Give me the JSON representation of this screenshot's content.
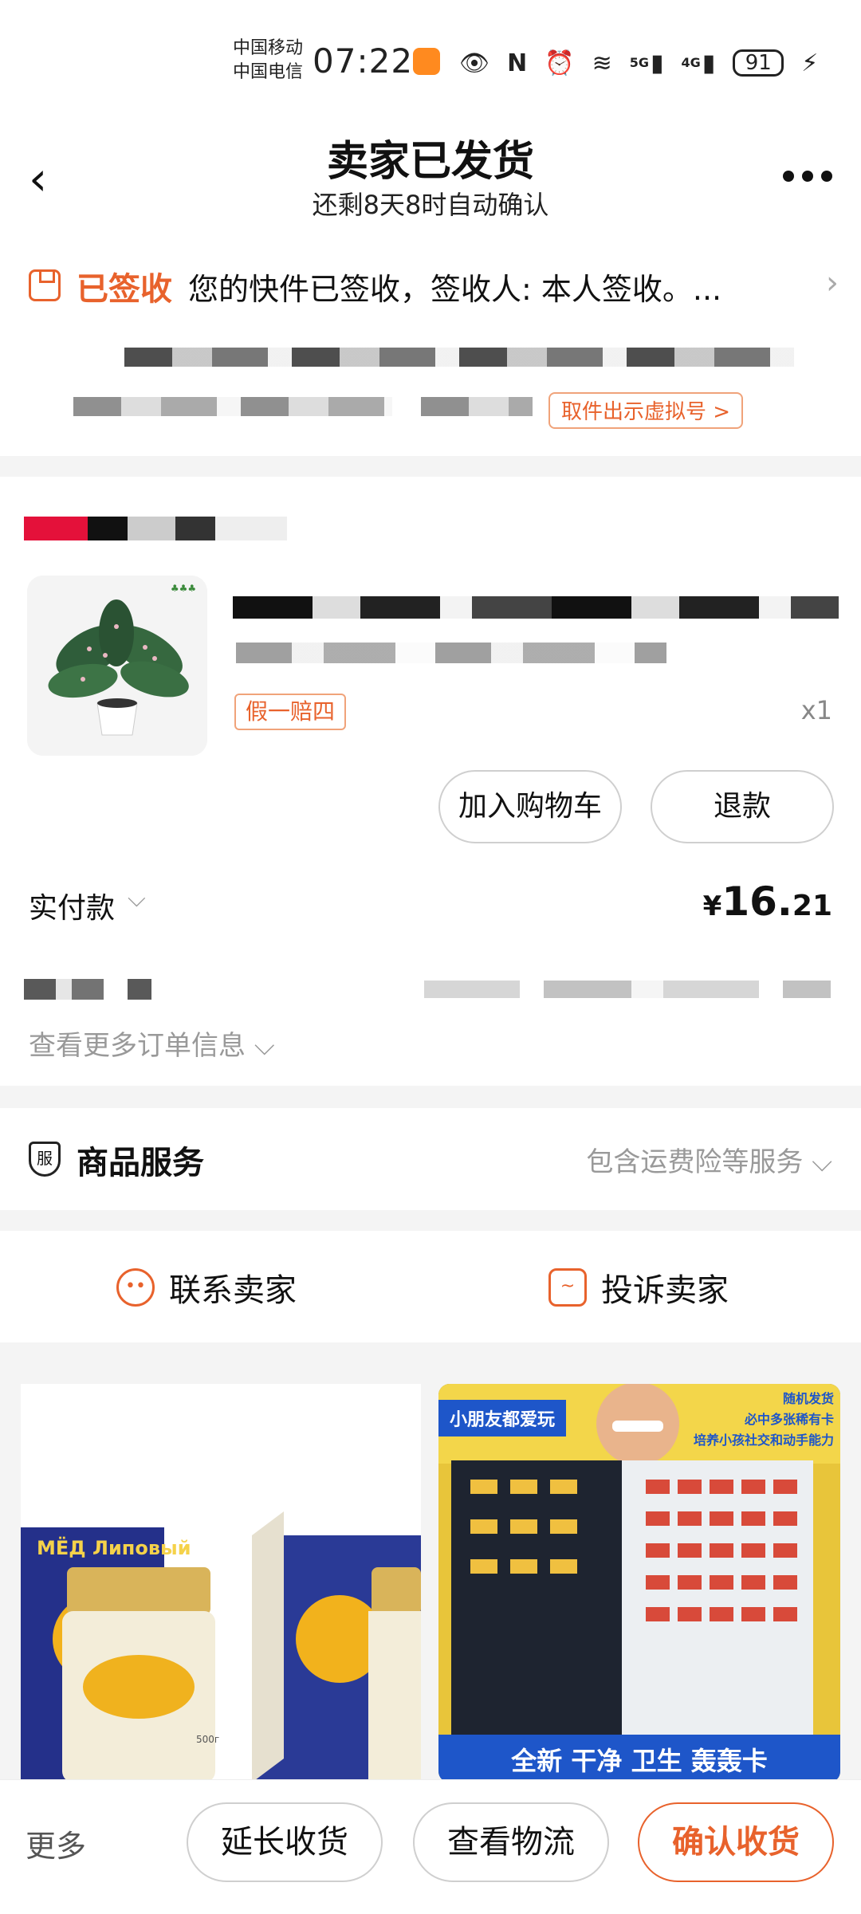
{
  "status_bar": {
    "carrier1": "中国移动",
    "carrier2": "中国电信",
    "time": "07:22",
    "net1": "5G",
    "net2": "4G",
    "battery": "91"
  },
  "nav": {
    "title": "卖家已发货",
    "subtitle": "还剩8天8时自动确认"
  },
  "logistics": {
    "status": "已签收",
    "message": "您的快件已签收，签收人: 本人签收。...",
    "pickup_button": "取件出示虚拟号 >"
  },
  "order": {
    "tag": "假一赔四",
    "quantity": "x1",
    "add_cart": "加入购物车",
    "refund": "退款",
    "paid_label": "实付款",
    "currency": "¥",
    "price_int": "16.",
    "price_dec": "21",
    "more_info": "查看更多订单信息"
  },
  "service": {
    "icon_text": "服",
    "title": "商品服务",
    "desc": "包含运费险等服务"
  },
  "contact": {
    "contact_seller": "联系卖家",
    "complain_seller": "投诉卖家"
  },
  "recommend": {
    "left_brand": "МЁД Липовый",
    "left_weight": "500г",
    "right_banner": "小朋友都爱玩",
    "right_promo_1": "随机发货",
    "right_promo_2": "必中多张稀有卡",
    "right_promo_3": "培养小孩社交和动手能力",
    "right_bottom": "全新 干净 卫生 轰轰卡"
  },
  "bottom_bar": {
    "more": "更多",
    "extend": "延长收货",
    "logistics": "查看物流",
    "confirm": "确认收货"
  },
  "colors": {
    "accent": "#e8622c",
    "page_bg": "#f4f4f4"
  }
}
